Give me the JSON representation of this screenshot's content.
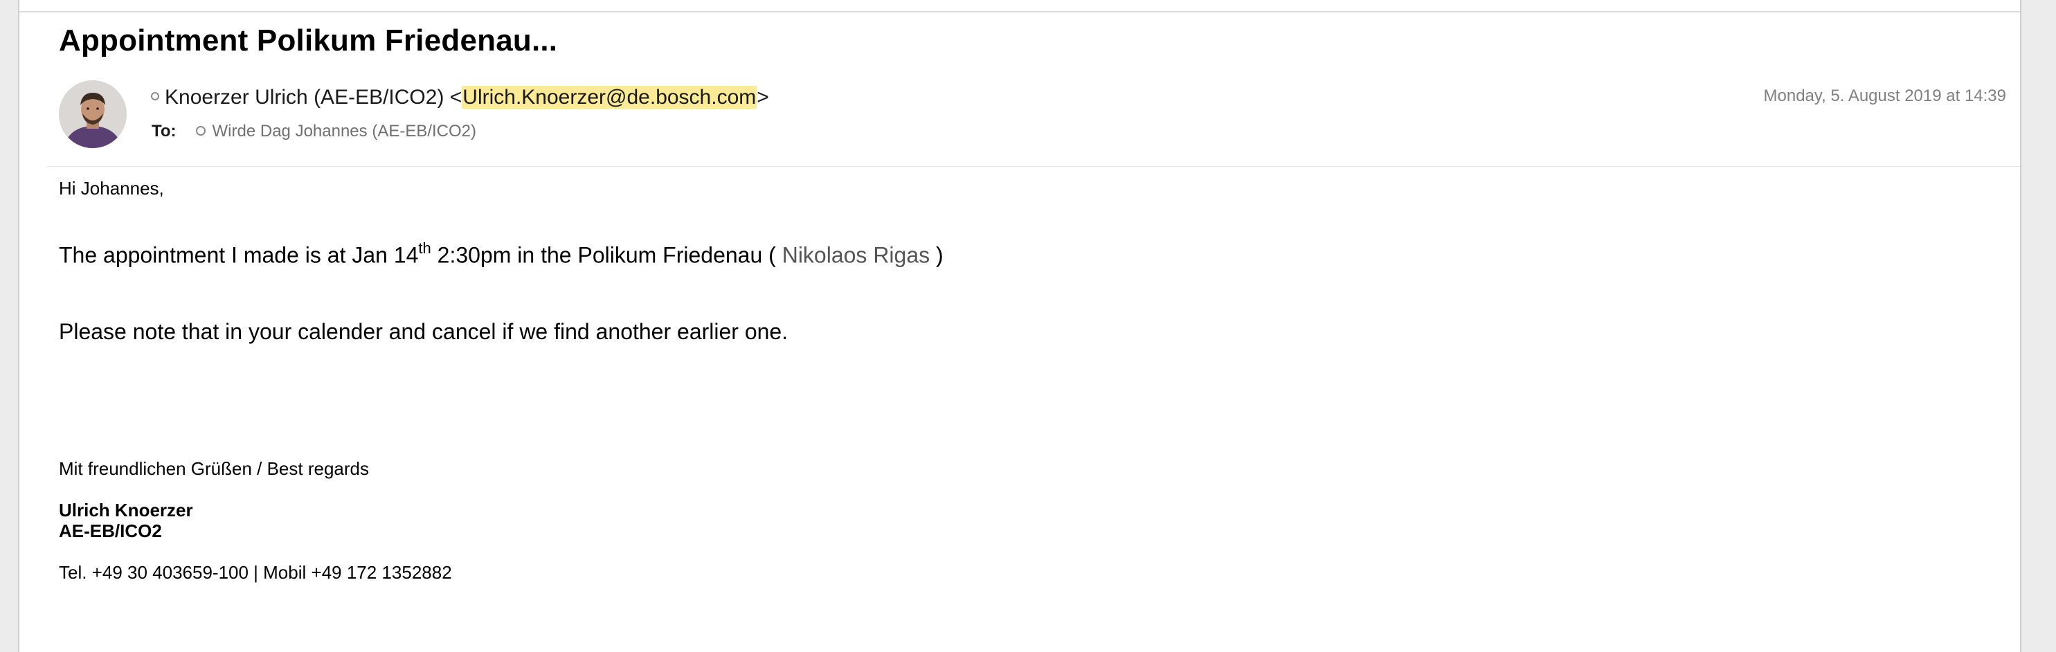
{
  "message": {
    "subject": "Appointment Polikum Friedenau...",
    "from_name": "Knoerzer Ulrich (AE-EB/ICO2)",
    "from_email": "Ulrich.Knoerzer@de.bosch.com",
    "to_label": "To:",
    "to_recipient": "Wirde Dag Johannes (AE-EB/ICO2)",
    "date": "Monday, 5. August 2019 at 14:39"
  },
  "body": {
    "greeting": "Hi Johannes,",
    "para1_before": "The appointment I made is at Jan 14",
    "para1_sup": "th",
    "para1_after": " 2:30pm in the Polikum Friedenau ( ",
    "para1_link": "Nikolaos Rigas",
    "para1_end": " )",
    "para2": "Please note that in your calender and cancel if we find another earlier one.",
    "closing": "Mit freundlichen Grüßen / Best regards",
    "signature_name": "Ulrich Knoerzer",
    "signature_dept": "AE-EB/ICO2",
    "signature_phone": "Tel. +49 30 403659-100 | Mobil +49 172 1352882"
  },
  "colors": {
    "email_highlight": "#fbeb97",
    "muted_text": "#808080"
  }
}
